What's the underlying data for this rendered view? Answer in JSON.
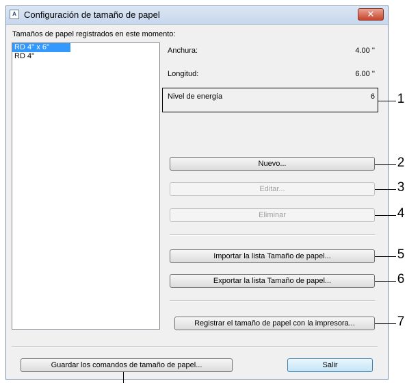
{
  "window": {
    "title": "Configuración de tamaño de papel",
    "close_label": "✕"
  },
  "list": {
    "label": "Tamaños de papel registrados en este momento:",
    "items": [
      "RD 4'' x 6''",
      "RD 4''"
    ],
    "selected_index": 0
  },
  "details": {
    "width_label": "Anchura:",
    "width_value": "4.00 ''",
    "length_label": "Longitud:",
    "length_value": "6.00 ''",
    "energy_label": "Nivel de energía",
    "energy_value": "6"
  },
  "buttons": {
    "new": "Nuevo...",
    "edit": "Editar...",
    "delete": "Eliminar",
    "import": "Importar la lista Tamaño de papel...",
    "export": "Exportar la lista Tamaño de papel...",
    "register": "Registrar el tamaño de papel con la impresora...",
    "save_commands": "Guardar los comandos de tamaño de papel...",
    "exit": "Salir"
  },
  "callouts": [
    "1",
    "2",
    "3",
    "4",
    "5",
    "6",
    "7"
  ]
}
